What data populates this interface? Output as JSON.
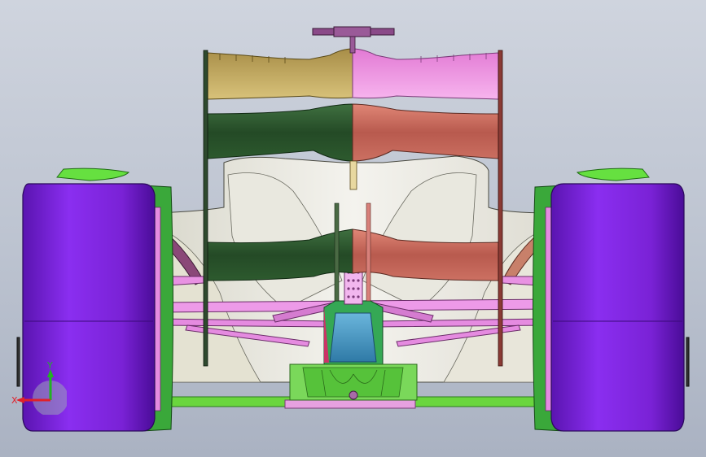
{
  "viewport": {
    "background_top": "#cfd4de",
    "background_bottom": "#aab2c2"
  },
  "triad": {
    "x_label": "X",
    "y_label": "Y",
    "x_color": "#e0202a",
    "y_color": "#22b322"
  },
  "colors": {
    "tire": "#7a22d6",
    "tire_dark": "#5510a8",
    "rim": "#3aa83a",
    "wing_left": "#2e5a2e",
    "wing_right": "#c86b5e",
    "flap_left": "#b8a058",
    "flap_right": "#ef8ce0",
    "body": "#e6e4dc",
    "suspension": "#e58be0",
    "floor": "#66d63e",
    "diffuser": "#4aa0c8",
    "pylon": "#cc3366"
  }
}
